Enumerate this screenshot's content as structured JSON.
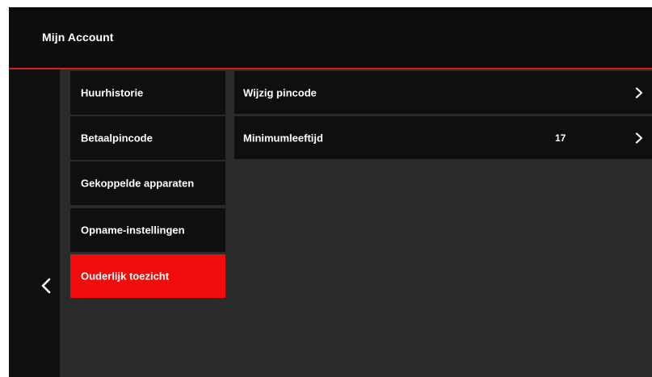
{
  "header": {
    "title": "Mijn Account"
  },
  "nav": {
    "back_icon": "chevron-left-icon"
  },
  "menu": {
    "items": [
      {
        "label": "Huurhistorie",
        "active": false
      },
      {
        "label": "Betaalpincode",
        "active": false
      },
      {
        "label": "Gekoppelde apparaten",
        "active": false
      },
      {
        "label": "Opname-instellingen",
        "active": false
      },
      {
        "label": "Ouderlijk toezicht",
        "active": true
      }
    ]
  },
  "settings": {
    "rows": [
      {
        "label": "Wijzig pincode",
        "value": "",
        "icon": "chevron-right-icon"
      },
      {
        "label": "Minimumleeftijd",
        "value": "17",
        "icon": "chevron-right-icon"
      }
    ]
  },
  "colors": {
    "accent": "#f20d0d",
    "header_border": "#d81e1e",
    "panel_bg": "#2b2b2b",
    "item_bg": "#0f0f0f",
    "header_bg": "#0d0d0d"
  }
}
